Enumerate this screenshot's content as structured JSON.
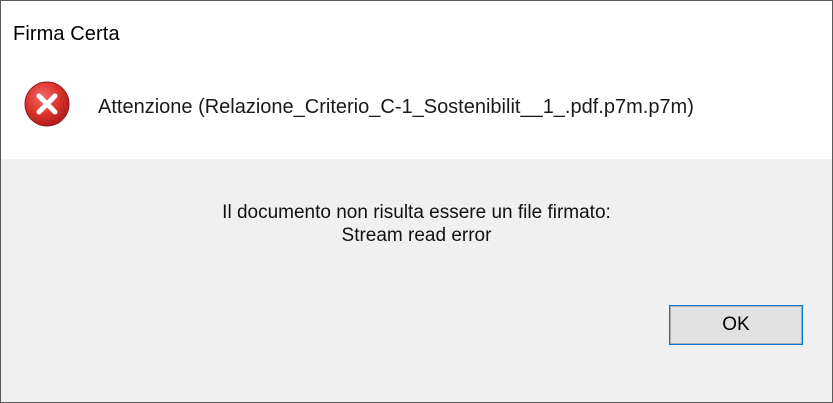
{
  "window": {
    "title": "Firma Certa"
  },
  "header": {
    "icon": "error-icon",
    "text": "Attenzione (Relazione_Criterio_C-1_Sostenibilit__1_.pdf.p7m.p7m)"
  },
  "message": {
    "line1": "Il documento non risulta essere un file firmato:",
    "line2": "Stream read error"
  },
  "buttons": {
    "ok_label": "OK"
  },
  "colors": {
    "error_red": "#e81123",
    "accent_focus": "#0078d7",
    "body_background": "#f0f0f0"
  }
}
